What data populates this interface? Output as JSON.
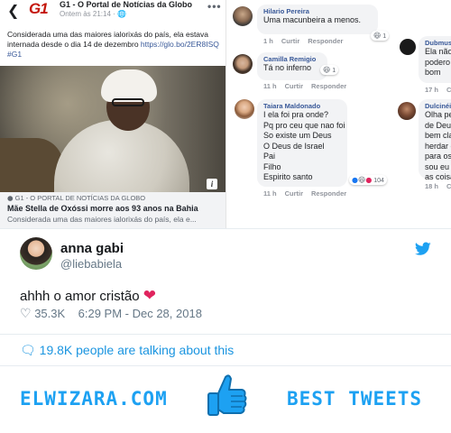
{
  "post": {
    "back_icon": "arrow-left-icon",
    "logo_text": "G1",
    "page_name": "G1 - O Portal de Notícias da Globo",
    "time": "Ontem às 21:14 · ",
    "time_icon": "globe-icon",
    "more_icon": "more-icon",
    "text": "Considerada uma das maiores ialorixás do país, ela estava internada desde o dia 14 de dezembro ",
    "link": "https://glo.bo/2ER8ISQ #G1",
    "photo_icon": "info-icon",
    "preview": {
      "source": "G1 - O PORTAL DE NOTÍCIAS DA GLOBO",
      "title": "Mãe Stella de Oxóssi morre aos 93 anos na Bahia",
      "description": "Considerada uma das maiores ialorixás do país, ela e..."
    }
  },
  "comments": [
    {
      "name": "Hilario Pereira",
      "lines": [
        "Uma  macunbeira  a menos."
      ],
      "time": "1 h",
      "reaction_count": "1",
      "actions": [
        "Curtir",
        "Responder"
      ]
    },
    {
      "name": "Camilla Remigio",
      "lines": [
        "Tá no inferno"
      ],
      "time": "11 h",
      "reaction_count": "1",
      "actions": [
        "Curtir",
        "Responder"
      ]
    },
    {
      "name": "Taiara Maldonado",
      "lines": [
        "I ela foi pra onde?",
        "Pq pro ceu que nao foi",
        "So existe um Deus",
        "O Deus de Israel",
        "Pai",
        "Filho",
        "Espirito santo"
      ],
      "time": "11 h",
      "reaction_count": "104",
      "actions": [
        "Curtir",
        "Responder"
      ]
    },
    {
      "name": "Dubmus",
      "lines": [
        "Ela não",
        "podero",
        "bom"
      ],
      "time": "17 h",
      "actions": [
        "C"
      ]
    },
    {
      "name": "Dulcinéia",
      "lines": [
        "Olha pel",
        "de Deus",
        "bem clar",
        "herdar o",
        "para os",
        "sou eu p",
        "as coisa"
      ],
      "time": "18 h",
      "actions": [
        "Cu"
      ]
    }
  ],
  "tweet": {
    "name": "anna gabi",
    "handle": "@liebabiela",
    "text": "ahhh o amor cristão ",
    "heart_emoji": "❤",
    "likes": "35.3K",
    "datetime": "6:29 PM - Dec 28, 2018",
    "talking": "19.8K people are talking about this",
    "like_icon": "heart-outline-icon",
    "talk_icon": "speech-bubble-icon",
    "bird_icon": "twitter-bird-icon"
  },
  "footer": {
    "brand": "ELWIZARA.COM",
    "tagline": "BEST TWEETS",
    "thumb_icon": "thumbs-up-icon"
  },
  "colors": {
    "g1_red": "#c4170c",
    "fb_blue": "#385898",
    "twitter_blue": "#1da1f2",
    "heart_red": "#e0245e"
  }
}
